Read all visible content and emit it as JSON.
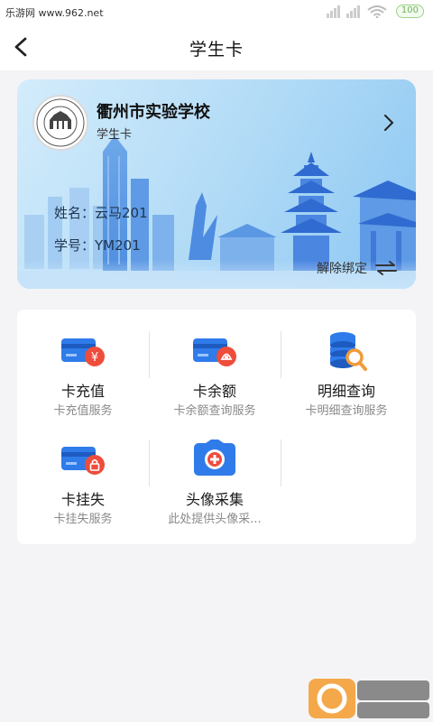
{
  "status_bar": {
    "left_text": "乐游网 www.962.net",
    "battery": "100"
  },
  "header": {
    "title": "学生卡",
    "back_icon": "back-arrow-icon"
  },
  "card": {
    "school_name": "衢州市实验学校",
    "card_type": "学生卡",
    "name_label": "姓名：",
    "name_value": "云马201",
    "id_label": "学号：",
    "id_value": "YM201",
    "unbind_label": "解除绑定",
    "colors": {
      "gradient_start": "#d3ecfb",
      "gradient_end": "#8cc7f2",
      "city": "#4b86e0"
    }
  },
  "services": [
    {
      "label": "卡充值",
      "sub": "卡充值服务",
      "icon": "card-recharge-icon"
    },
    {
      "label": "卡余额",
      "sub": "卡余额查询服务",
      "icon": "card-balance-icon"
    },
    {
      "label": "明细查询",
      "sub": "卡明细查询服务",
      "icon": "detail-query-icon"
    },
    {
      "label": "卡挂失",
      "sub": "卡挂失服务",
      "icon": "card-lost-icon"
    },
    {
      "label": "头像采集",
      "sub": "此处提供头像采...",
      "icon": "camera-icon"
    }
  ],
  "accent_colors": {
    "blue": "#2f7bea",
    "red": "#ee4d3c",
    "orange": "#f29a3a"
  },
  "watermark": "962.NET 乐游网"
}
